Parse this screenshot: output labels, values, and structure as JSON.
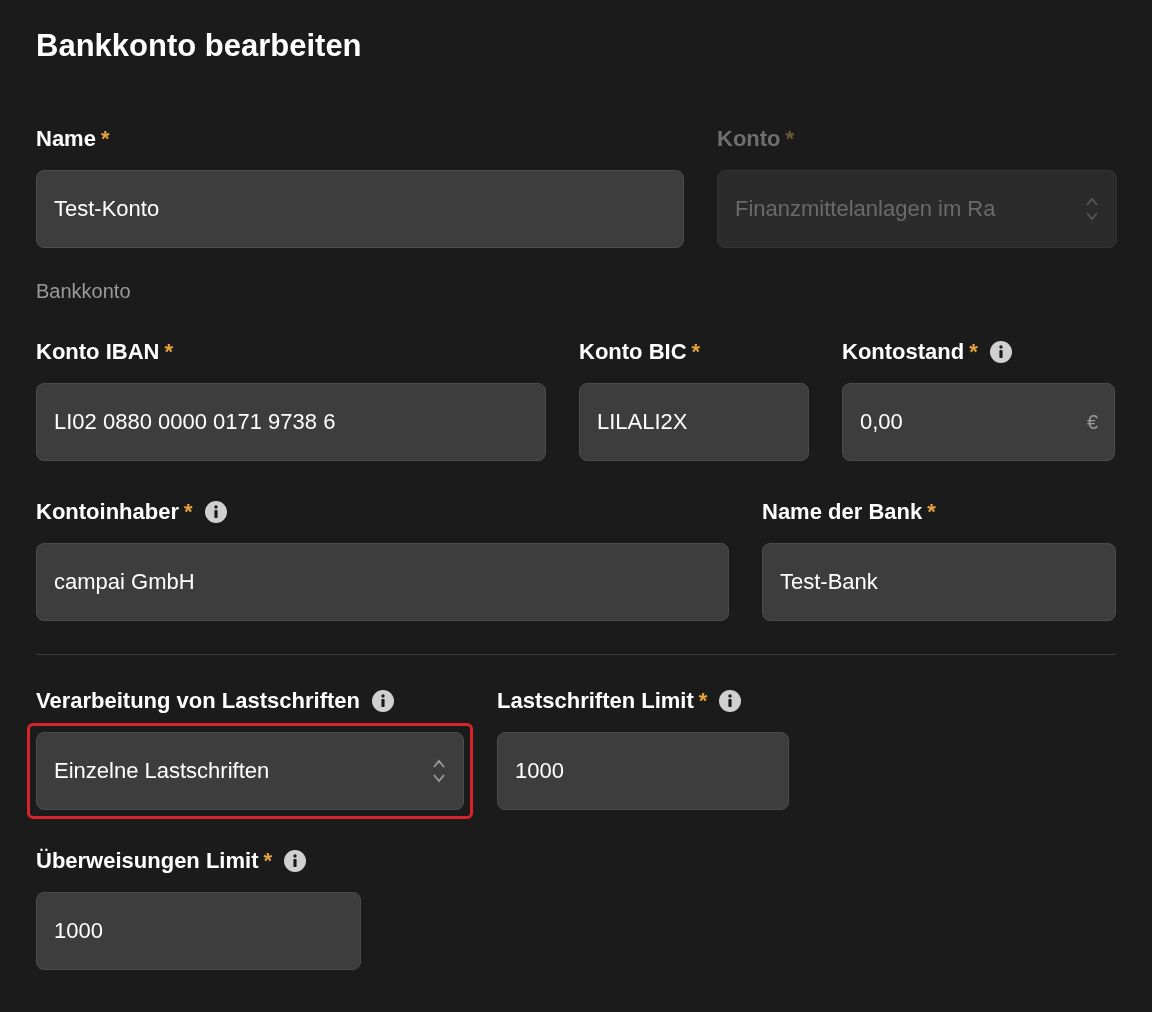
{
  "title": "Bankkonto bearbeiten",
  "rows": [
    {
      "fields": [
        {
          "kind": "text",
          "label": "Name",
          "asterisk": "*",
          "value": "Test-Konto",
          "disabled": false
        },
        {
          "kind": "select",
          "label": "Konto",
          "asterisk": "*",
          "value": "Finanzmittelanlagen im Ra",
          "disabled": true
        }
      ]
    },
    {
      "heading": "Bankkonto",
      "fields": [
        {
          "kind": "text",
          "label": "Konto IBAN",
          "asterisk": "*",
          "value": "LI02 0880 0000 0171 9738 6",
          "disabled": false
        },
        {
          "kind": "text",
          "label": "Konto BIC",
          "asterisk": "*",
          "value": "LILALI2X",
          "disabled": false
        },
        {
          "kind": "text",
          "label": "Kontostand",
          "asterisk": "*",
          "info": true,
          "value": "0,00",
          "suffix": "€",
          "disabled": false
        }
      ]
    },
    {
      "fields": [
        {
          "kind": "text",
          "label": "Kontoinhaber",
          "asterisk": "*",
          "info": true,
          "value": "campai GmbH",
          "disabled": false
        },
        {
          "kind": "text",
          "label": "Name der Bank",
          "asterisk": "*",
          "value": "Test-Bank",
          "disabled": false
        }
      ]
    },
    {
      "divider": true,
      "fields": [
        {
          "kind": "select",
          "label": "Verarbeitung von Lastschriften",
          "info": true,
          "value": "Einzelne Lastschriften",
          "disabled": false,
          "highlighted": true
        },
        {
          "kind": "text",
          "label": "Lastschriften Limit",
          "asterisk": "*",
          "info": true,
          "value": "1000",
          "disabled": false
        }
      ]
    },
    {
      "fields": [
        {
          "kind": "text",
          "label": "Überweisungen Limit",
          "asterisk": "*",
          "info": true,
          "value": "1000",
          "disabled": false
        }
      ]
    }
  ]
}
